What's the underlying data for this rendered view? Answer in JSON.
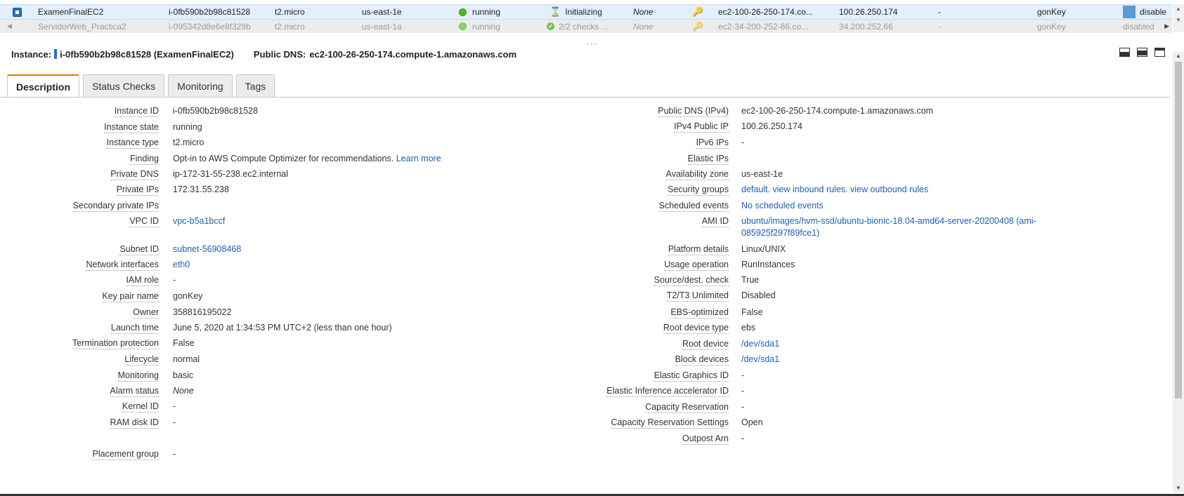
{
  "instances": [
    {
      "name": "ExamenFinalEC2",
      "id": "i-0fb590b2b98c81528",
      "type": "t2.micro",
      "az": "us-east-1e",
      "state": "running",
      "status_checks": "Initializing",
      "alarm_status": "None",
      "public_dns": "ec2-100-26-250-174.co...",
      "public_ip": "100.26.250.174",
      "ipv6": "-",
      "key_name": "gonKey",
      "monitoring": "disable"
    },
    {
      "name": "ServidorWeb_Practica2",
      "id": "i-095342d8e6e8f329b",
      "type": "t2.micro",
      "az": "us-east-1a",
      "state": "running",
      "status_checks": "2/2 checks ...",
      "alarm_status": "None",
      "public_dns": "ec2-34-200-252-66.co...",
      "public_ip": "34.200.252.66",
      "ipv6": "-",
      "key_name": "gonKey",
      "monitoring": "disabled"
    }
  ],
  "detail_header": {
    "instance_label": "Instance:",
    "instance_value": "i-0fb590b2b98c81528 (ExamenFinalEC2)",
    "dns_label": "Public DNS:",
    "dns_value": "ec2-100-26-250-174.compute-1.amazonaws.com"
  },
  "tabs": [
    "Description",
    "Status Checks",
    "Monitoring",
    "Tags"
  ],
  "description_left": [
    {
      "label": "Instance ID",
      "value": "i-0fb590b2b98c81528"
    },
    {
      "label": "Instance state",
      "value": "running"
    },
    {
      "label": "Instance type",
      "value": "t2.micro"
    },
    {
      "label": "Finding",
      "value": "Opt-in to AWS Compute Optimizer for recommendations.",
      "link": "Learn more"
    },
    {
      "label": "Private DNS",
      "value": "ip-172-31-55-238.ec2.internal"
    },
    {
      "label": "Private IPs",
      "value": "172.31.55.238"
    },
    {
      "label": "Secondary private IPs",
      "value": ""
    },
    {
      "label": "VPC ID",
      "link": "vpc-b5a1bccf"
    },
    {
      "label": "Subnet ID",
      "link": "subnet-56908468"
    },
    {
      "label": "Network interfaces",
      "link": "eth0"
    },
    {
      "label": "IAM role",
      "value": "-"
    },
    {
      "label": "Key pair name",
      "value": "gonKey"
    },
    {
      "label": "Owner",
      "value": "358816195022"
    },
    {
      "label": "Launch time",
      "value": "June 5, 2020 at 1:34:53 PM UTC+2 (less than one hour)"
    },
    {
      "label": "Termination protection",
      "value": "False"
    },
    {
      "label": "Lifecycle",
      "value": "normal"
    },
    {
      "label": "Monitoring",
      "value": "basic"
    },
    {
      "label": "Alarm status",
      "value": "None"
    },
    {
      "label": "Kernel ID",
      "value": "-"
    },
    {
      "label": "RAM disk ID",
      "value": "-"
    },
    {
      "label": "Placement group",
      "value": "-"
    }
  ],
  "description_right": [
    {
      "label": "Public DNS (IPv4)",
      "value": "ec2-100-26-250-174.compute-1.amazonaws.com"
    },
    {
      "label": "IPv4 Public IP",
      "value": "100.26.250.174"
    },
    {
      "label": "IPv6 IPs",
      "value": "-"
    },
    {
      "label": "Elastic IPs",
      "value": ""
    },
    {
      "label": "Availability zone",
      "value": "us-east-1e"
    },
    {
      "label": "Security groups",
      "link1": "default.",
      "link2": "view inbound rules.",
      "link3": "view outbound rules"
    },
    {
      "label": "Scheduled events",
      "link": "No scheduled events"
    },
    {
      "label": "AMI ID",
      "link_line1": "ubuntu/images/hvm-ssd/ubuntu-bionic-18.04-amd64-server-20200408 (ami-",
      "link_line2": "085925f297f89fce1)"
    },
    {
      "label": "Platform details",
      "value": "Linux/UNIX"
    },
    {
      "label": "Usage operation",
      "value": "RunInstances"
    },
    {
      "label": "Source/dest. check",
      "value": "True"
    },
    {
      "label": "T2/T3 Unlimited",
      "value": "Disabled"
    },
    {
      "label": "EBS-optimized",
      "value": "False"
    },
    {
      "label": "Root device type",
      "value": "ebs"
    },
    {
      "label": "Root device",
      "link": "/dev/sda1"
    },
    {
      "label": "Block devices",
      "link": "/dev/sda1"
    },
    {
      "label": "Elastic Graphics ID",
      "value": "-"
    },
    {
      "label": "Elastic Inference accelerator ID",
      "value": "-"
    },
    {
      "label": "Capacity Reservation",
      "value": "-"
    },
    {
      "label": "Capacity Reservation Settings",
      "value": "Open"
    },
    {
      "label": "Outpost Arn",
      "value": "-"
    }
  ],
  "colors": {
    "link": "#1f5fb3",
    "running": "#4cbb17",
    "active_tab": "#e07b00",
    "selected_row": "#e3effa"
  }
}
